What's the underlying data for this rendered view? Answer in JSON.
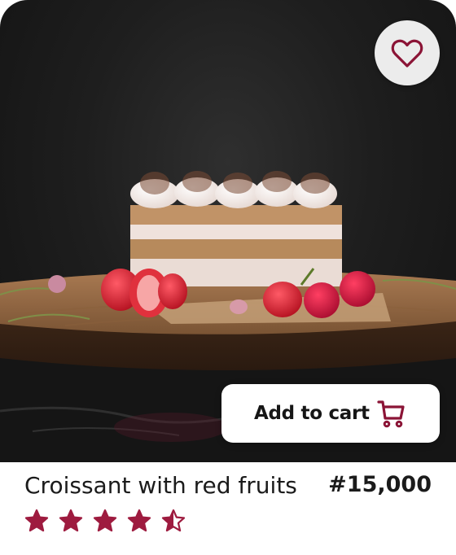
{
  "product": {
    "title": "Croissant with red fruits",
    "price": "#15,000",
    "rating": 4.5,
    "rating_max": 5
  },
  "actions": {
    "add_to_cart_label": "Add to cart",
    "add_to_cart_icon": "shopping-cart-icon",
    "favorite_icon": "heart-outline-icon"
  },
  "colors": {
    "accent": "#8b1436",
    "star": "#9e1b3f",
    "background_dark": "#1c1c1c"
  }
}
